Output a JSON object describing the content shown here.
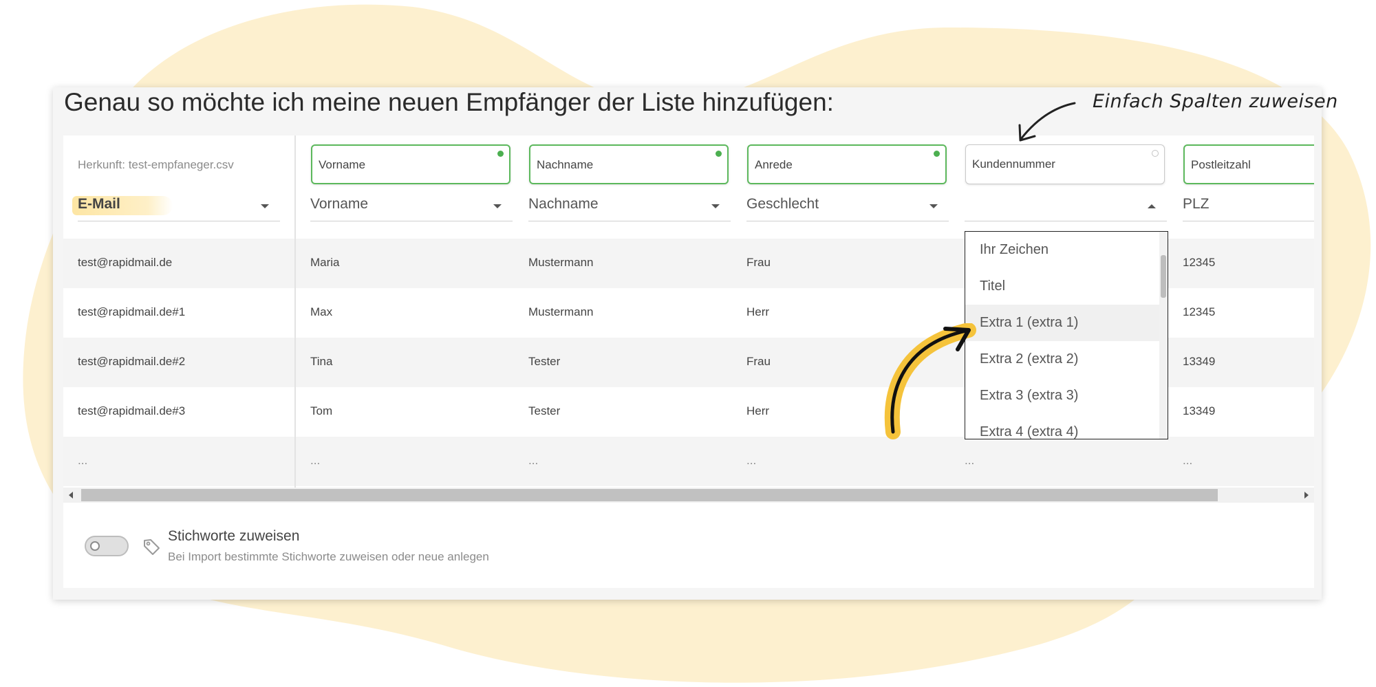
{
  "heading": "Genau so möchte ich meine neuen Empfänger der Liste hinzufügen:",
  "annotation": "Einfach Spalten zuweisen",
  "origin_label": "Herkunft: test-empfaneger.csv",
  "columns": [
    {
      "field": "",
      "select": "E-Mail",
      "mapped": true
    },
    {
      "field": "Vorname",
      "select": "Vorname",
      "mapped": true
    },
    {
      "field": "Nachname",
      "select": "Nachname",
      "mapped": true
    },
    {
      "field": "Anrede",
      "select": "Geschlecht",
      "mapped": true
    },
    {
      "field": "Kundennummer",
      "select": "",
      "mapped": false
    },
    {
      "field": "Postleitzahl",
      "select": "PLZ",
      "mapped": true
    }
  ],
  "rows": [
    [
      "test@rapidmail.de",
      "Maria",
      "Mustermann",
      "Frau",
      "",
      "12345"
    ],
    [
      "test@rapidmail.de#1",
      "Max",
      "Mustermann",
      "Herr",
      "",
      "12345"
    ],
    [
      "test@rapidmail.de#2",
      "Tina",
      "Tester",
      "Frau",
      "",
      "13349"
    ],
    [
      "test@rapidmail.de#3",
      "Tom",
      "Tester",
      "Herr",
      "",
      "13349"
    ],
    [
      "...",
      "...",
      "...",
      "...",
      "...",
      "..."
    ]
  ],
  "dropdown": {
    "options": [
      "Ihr Zeichen",
      "Titel",
      "Extra 1 (extra 1)",
      "Extra 2 (extra 2)",
      "Extra 3 (extra 3)",
      "Extra 4 (extra 4)"
    ],
    "hovered_index": 2
  },
  "footer": {
    "title": "Stichworte zuweisen",
    "subtitle": "Bei Import bestimmte Stichworte zuweisen oder neue anlegen",
    "toggle_on": false
  },
  "colors": {
    "accent_green": "#5cb85c",
    "blob_yellow": "#fdf0cf",
    "arrow_yellow": "#f5c33b"
  },
  "icons": [
    "tag-icon",
    "caret-down-icon",
    "caret-up-icon",
    "scroll-left-icon",
    "scroll-right-icon",
    "curved-arrow-icon",
    "pointer-arrow-icon"
  ]
}
